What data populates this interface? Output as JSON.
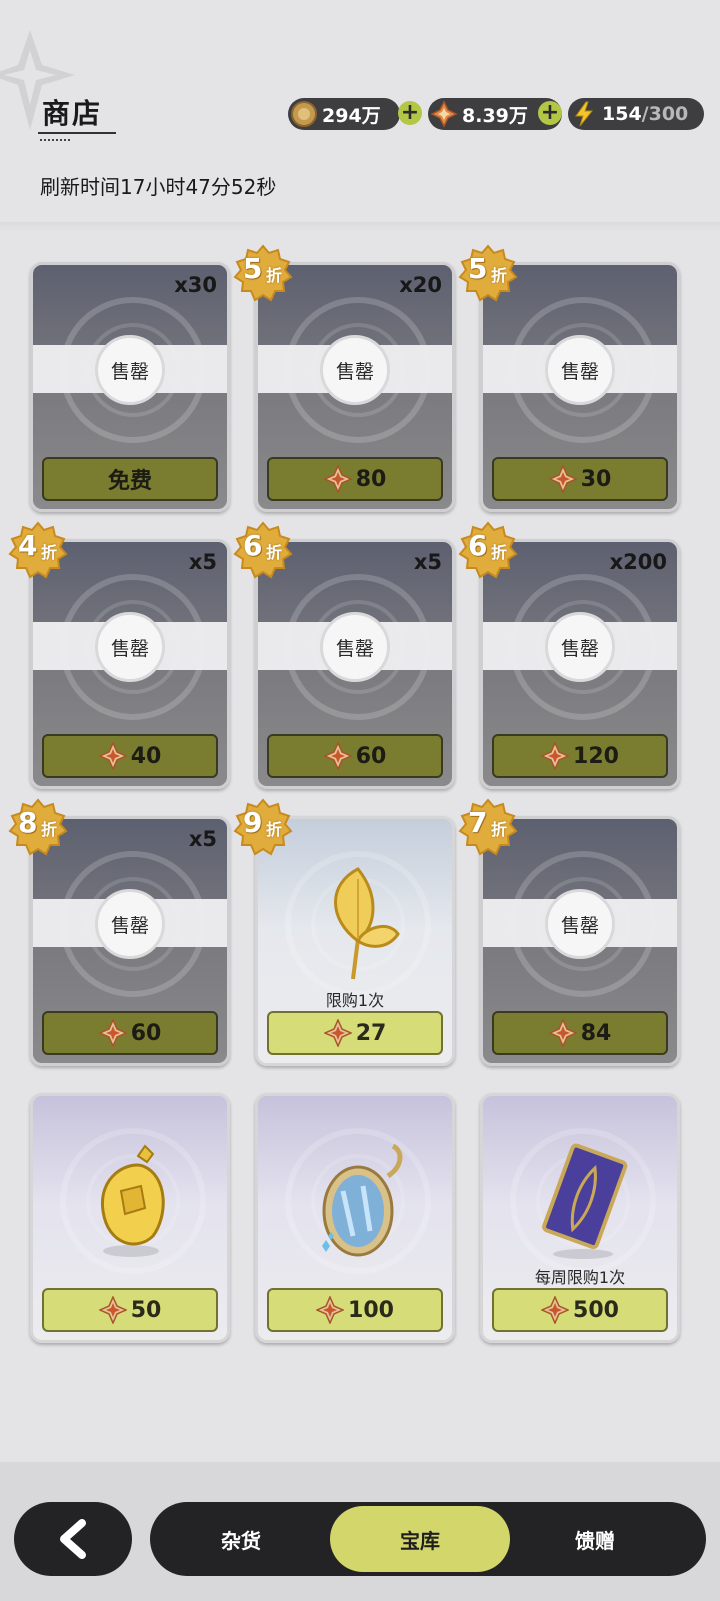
{
  "header": {
    "title": "商店",
    "refresh_text": "刷新时间17小时47分52秒"
  },
  "currencies": [
    {
      "icon": "coin-icon",
      "value": "294万"
    },
    {
      "icon": "gem-icon",
      "value": "8.39万"
    },
    {
      "icon": "lightning-icon",
      "value": "154",
      "max": "/300"
    }
  ],
  "sold_label": "售罄",
  "cards": [
    {
      "status": "sold",
      "qty": "x30",
      "discount": null,
      "price": "免费",
      "limit": ""
    },
    {
      "status": "sold",
      "qty": "x20",
      "discount": "5",
      "price": "80",
      "limit": ""
    },
    {
      "status": "sold",
      "qty": "",
      "discount": "5",
      "price": "30",
      "limit": ""
    },
    {
      "status": "sold",
      "qty": "x5",
      "discount": "4",
      "price": "40",
      "limit": ""
    },
    {
      "status": "sold",
      "qty": "x5",
      "discount": "6",
      "price": "60",
      "limit": ""
    },
    {
      "status": "sold",
      "qty": "x200",
      "discount": "6",
      "price": "120",
      "limit": ""
    },
    {
      "status": "sold",
      "qty": "x5",
      "discount": "8",
      "price": "60",
      "limit": ""
    },
    {
      "status": "available",
      "qty": "",
      "discount": "9",
      "price": "27",
      "limit": "限购1次",
      "item": "golden-leaf-icon"
    },
    {
      "status": "sold",
      "qty": "",
      "discount": "7",
      "price": "84",
      "limit": ""
    },
    {
      "status": "available",
      "qty": "",
      "discount": null,
      "price": "50",
      "limit": "",
      "item": "golden-ornament-icon"
    },
    {
      "status": "available",
      "qty": "",
      "discount": null,
      "price": "100",
      "limit": "",
      "item": "mirror-icon"
    },
    {
      "status": "available",
      "qty": "",
      "discount": null,
      "price": "500",
      "limit": "每周限购1次",
      "item": "purple-card-icon"
    }
  ],
  "discount_suffix": "折",
  "nav": {
    "back_icon": "chevron-left-icon",
    "tabs": [
      {
        "label": "杂货",
        "active": false
      },
      {
        "label": "宝库",
        "active": true
      },
      {
        "label": "馈赠",
        "active": false
      }
    ]
  },
  "colors": {
    "accent": "#d3d66a",
    "dark_button": "#7a7c30",
    "badge_gold": "#e0ac3c"
  }
}
